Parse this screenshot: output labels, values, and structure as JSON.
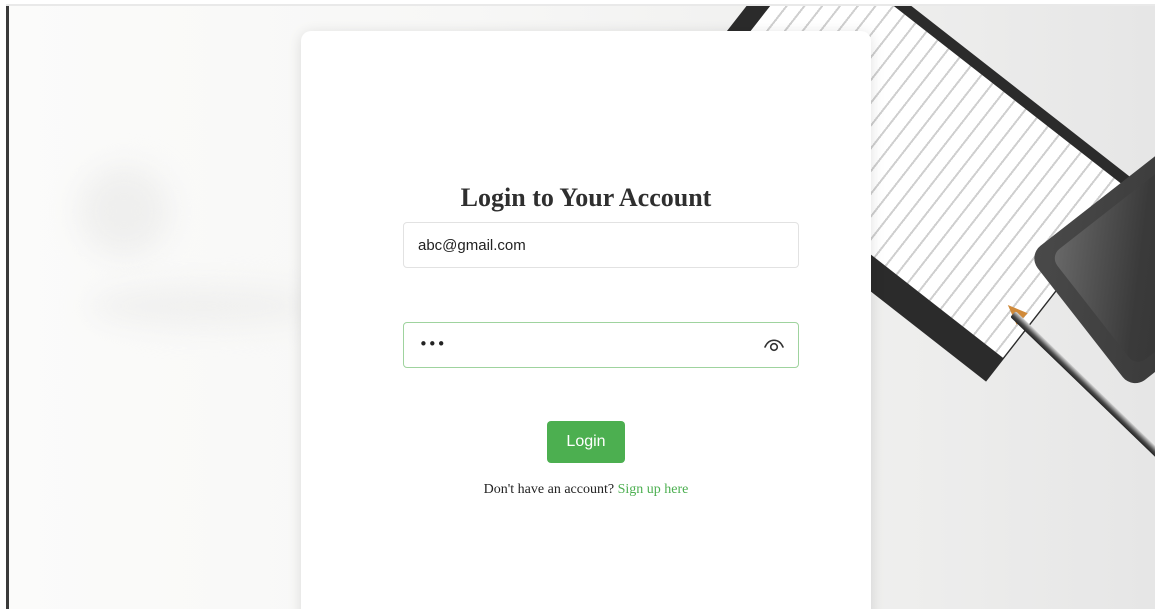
{
  "login": {
    "title": "Login to Your Account",
    "email_value": "abc@gmail.com",
    "password_masked": "•••",
    "login_button": "Login",
    "signup_prompt": "Don't have an account?",
    "signup_link": "Sign up here"
  },
  "icons": {
    "password_toggle": "eye-icon"
  },
  "colors": {
    "accent": "#4caf50",
    "password_border": "#9fd39e",
    "email_border": "#e2e2e2",
    "title": "#2f2f2f"
  }
}
